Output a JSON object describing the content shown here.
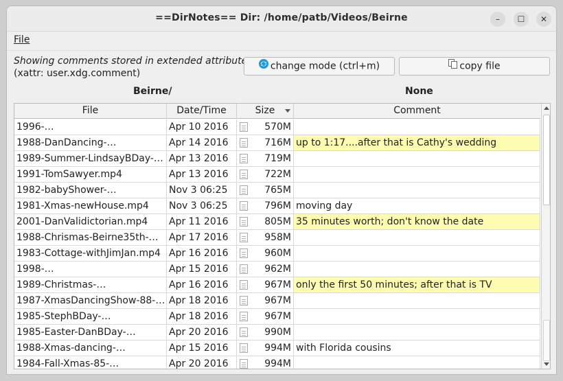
{
  "window": {
    "title": "==DirNotes==   Dir: /home/patb/Videos/Beirne",
    "minimize_glyph": "–",
    "maximize_glyph": "☐",
    "close_glyph": "✕"
  },
  "menu": {
    "file": "File"
  },
  "info": {
    "line1": "Showing comments stored in extended attributes",
    "line2": "(xattr: user.xdg.comment)"
  },
  "buttons": {
    "change_mode": "change mode (ctrl+m)",
    "change_mode_icon": "refresh-icon",
    "copy_file": "copy file",
    "copy_file_icon": "copy-icon"
  },
  "panes": {
    "left": "Beirne/",
    "right": "None"
  },
  "table": {
    "columns": [
      "File",
      "Date/Time",
      "Size",
      "Comment"
    ],
    "highlight_color": "#fefcb0",
    "rows": [
      {
        "file": "1996-…",
        "date": "Apr 10  2016",
        "size": "570M",
        "comment": "",
        "hl": false
      },
      {
        "file": "1988-DanDancing-…",
        "date": "Apr 14  2016",
        "size": "716M",
        "comment": "up to 1:17....after that is Cathy's wedding",
        "hl": true
      },
      {
        "file": "1989-Summer-LindsayBDay-…",
        "date": "Apr 13  2016",
        "size": "719M",
        "comment": "",
        "hl": false
      },
      {
        "file": "1991-TomSawyer.mp4",
        "date": "Apr 13  2016",
        "size": "722M",
        "comment": "",
        "hl": false
      },
      {
        "file": "1982-babyShower-…",
        "date": "Nov  3 06:25",
        "size": "765M",
        "comment": "",
        "hl": false
      },
      {
        "file": "1981-Xmas-newHouse.mp4",
        "date": "Nov  3 06:25",
        "size": "796M",
        "comment": "moving day",
        "hl": false
      },
      {
        "file": "2001-DanValidictorian.mp4",
        "date": "Apr 11  2016",
        "size": "805M",
        "comment": "35 minutes worth; don't know the date",
        "hl": true
      },
      {
        "file": "1988-Chrismas-Beirne35th-…",
        "date": "Apr 17  2016",
        "size": "958M",
        "comment": "",
        "hl": false
      },
      {
        "file": "1983-Cottage-withJimJan.mp4",
        "date": "Apr 16  2016",
        "size": "960M",
        "comment": "",
        "hl": false
      },
      {
        "file": "1998-…",
        "date": "Apr 15  2016",
        "size": "962M",
        "comment": "",
        "hl": false
      },
      {
        "file": "1989-Christmas-…",
        "date": "Apr 16  2016",
        "size": "967M",
        "comment": "only the first 50 minutes; after that is TV",
        "hl": true
      },
      {
        "file": "1987-XmasDancingShow-88-…",
        "date": "Apr 18  2016",
        "size": "967M",
        "comment": "",
        "hl": false
      },
      {
        "file": "1985-StephBDay-…",
        "date": "Apr 18  2016",
        "size": "967M",
        "comment": "",
        "hl": false
      },
      {
        "file": "1985-Easter-DanBDay-…",
        "date": "Apr 20  2016",
        "size": "990M",
        "comment": "",
        "hl": false
      },
      {
        "file": "1988-Xmas-dancing-…",
        "date": "Apr 15  2016",
        "size": "994M",
        "comment": "with Florida cousins",
        "hl": false
      },
      {
        "file": "1984-Fall-Xmas-85-…",
        "date": "Apr 20  2016",
        "size": "994M",
        "comment": "",
        "hl": false
      }
    ]
  }
}
